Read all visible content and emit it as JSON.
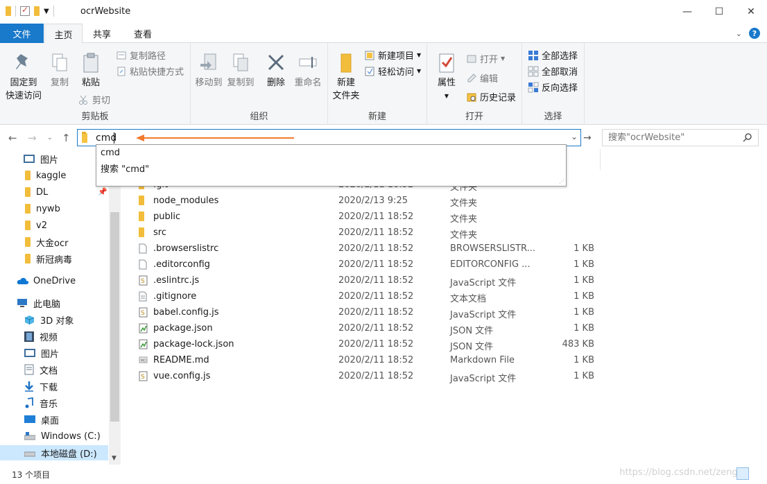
{
  "window": {
    "title": "ocrWebsite",
    "minimize_label": "—",
    "maximize_label": "☐",
    "close_label": "✕"
  },
  "ribbon_tabs": {
    "file": "文件",
    "home": "主页",
    "share": "共享",
    "view": "查看"
  },
  "ribbon": {
    "clipboard": {
      "label": "剪贴板",
      "pin": "固定到",
      "pin2": "快速访问",
      "copy": "复制",
      "paste": "粘贴",
      "copy_path": "复制路径",
      "paste_shortcut": "粘贴快捷方式",
      "cut": "剪切"
    },
    "organize": {
      "label": "组织",
      "move_to": "移动到",
      "copy_to": "复制到",
      "delete": "删除",
      "rename": "重命名"
    },
    "new": {
      "label": "新建",
      "new_folder": "新建",
      "new_folder2": "文件夹",
      "new_item": "新建项目",
      "easy_access": "轻松访问"
    },
    "open": {
      "label": "打开",
      "properties": "属性",
      "open": "打开",
      "edit": "编辑",
      "history": "历史记录"
    },
    "select": {
      "label": "选择",
      "select_all": "全部选择",
      "select_none": "全部取消",
      "invert": "反向选择"
    }
  },
  "address": {
    "value": "cmd",
    "search_placeholder": "搜索\"ocrWebsite\""
  },
  "suggestions": [
    "cmd",
    "搜索 \"cmd\""
  ],
  "nav_pane": [
    {
      "label": "图片",
      "icon": "pictures-icon"
    },
    {
      "label": "kaggle",
      "icon": "folder-icon"
    },
    {
      "label": "DL",
      "icon": "folder-icon"
    },
    {
      "label": "nywb",
      "icon": "folder-icon"
    },
    {
      "label": "v2",
      "icon": "folder-icon"
    },
    {
      "label": "大金ocr",
      "icon": "folder-icon"
    },
    {
      "label": "新冠病毒",
      "icon": "folder-icon"
    },
    {
      "label": "OneDrive",
      "icon": "cloud-icon"
    },
    {
      "label": "此电脑",
      "icon": "computer-icon"
    },
    {
      "label": "3D 对象",
      "icon": "cube-icon"
    },
    {
      "label": "视频",
      "icon": "video-icon"
    },
    {
      "label": "图片",
      "icon": "pictures-icon"
    },
    {
      "label": "文档",
      "icon": "document-icon"
    },
    {
      "label": "下载",
      "icon": "download-icon"
    },
    {
      "label": "音乐",
      "icon": "music-icon"
    },
    {
      "label": "桌面",
      "icon": "desktop-icon"
    },
    {
      "label": "Windows (C:)",
      "icon": "drive-icon"
    },
    {
      "label": "本地磁盘 (D:)",
      "icon": "drive-icon"
    }
  ],
  "files": [
    {
      "name": ".git",
      "date": "2020/2/11 18:52",
      "type": "文件夹",
      "size": "",
      "icon": "folder-icon"
    },
    {
      "name": "node_modules",
      "date": "2020/2/13 9:25",
      "type": "文件夹",
      "size": "",
      "icon": "folder-icon"
    },
    {
      "name": "public",
      "date": "2020/2/11 18:52",
      "type": "文件夹",
      "size": "",
      "icon": "folder-icon"
    },
    {
      "name": "src",
      "date": "2020/2/11 18:52",
      "type": "文件夹",
      "size": "",
      "icon": "folder-icon"
    },
    {
      "name": ".browserslistrc",
      "date": "2020/2/11 18:52",
      "type": "BROWSERSLISTR...",
      "size": "1 KB",
      "icon": "file-icon"
    },
    {
      "name": ".editorconfig",
      "date": "2020/2/11 18:52",
      "type": "EDITORCONFIG ...",
      "size": "1 KB",
      "icon": "file-icon"
    },
    {
      "name": ".eslintrc.js",
      "date": "2020/2/11 18:52",
      "type": "JavaScript 文件",
      "size": "1 KB",
      "icon": "js-file-icon"
    },
    {
      "name": ".gitignore",
      "date": "2020/2/11 18:52",
      "type": "文本文档",
      "size": "1 KB",
      "icon": "text-file-icon"
    },
    {
      "name": "babel.config.js",
      "date": "2020/2/11 18:52",
      "type": "JavaScript 文件",
      "size": "1 KB",
      "icon": "js-file-icon"
    },
    {
      "name": "package.json",
      "date": "2020/2/11 18:52",
      "type": "JSON 文件",
      "size": "1 KB",
      "icon": "json-file-icon"
    },
    {
      "name": "package-lock.json",
      "date": "2020/2/11 18:52",
      "type": "JSON 文件",
      "size": "483 KB",
      "icon": "json-file-icon"
    },
    {
      "name": "README.md",
      "date": "2020/2/11 18:52",
      "type": "Markdown File",
      "size": "1 KB",
      "icon": "markdown-file-icon"
    },
    {
      "name": "vue.config.js",
      "date": "2020/2/11 18:52",
      "type": "JavaScript 文件",
      "size": "1 KB",
      "icon": "js-file-icon"
    }
  ],
  "status": {
    "count": "13 个项目",
    "watermark": "https://blog.csdn.net/zeng..."
  },
  "colors": {
    "accent": "#1979ca",
    "folder": "#f5c242",
    "annotation_arrow": "#f07a2e"
  }
}
